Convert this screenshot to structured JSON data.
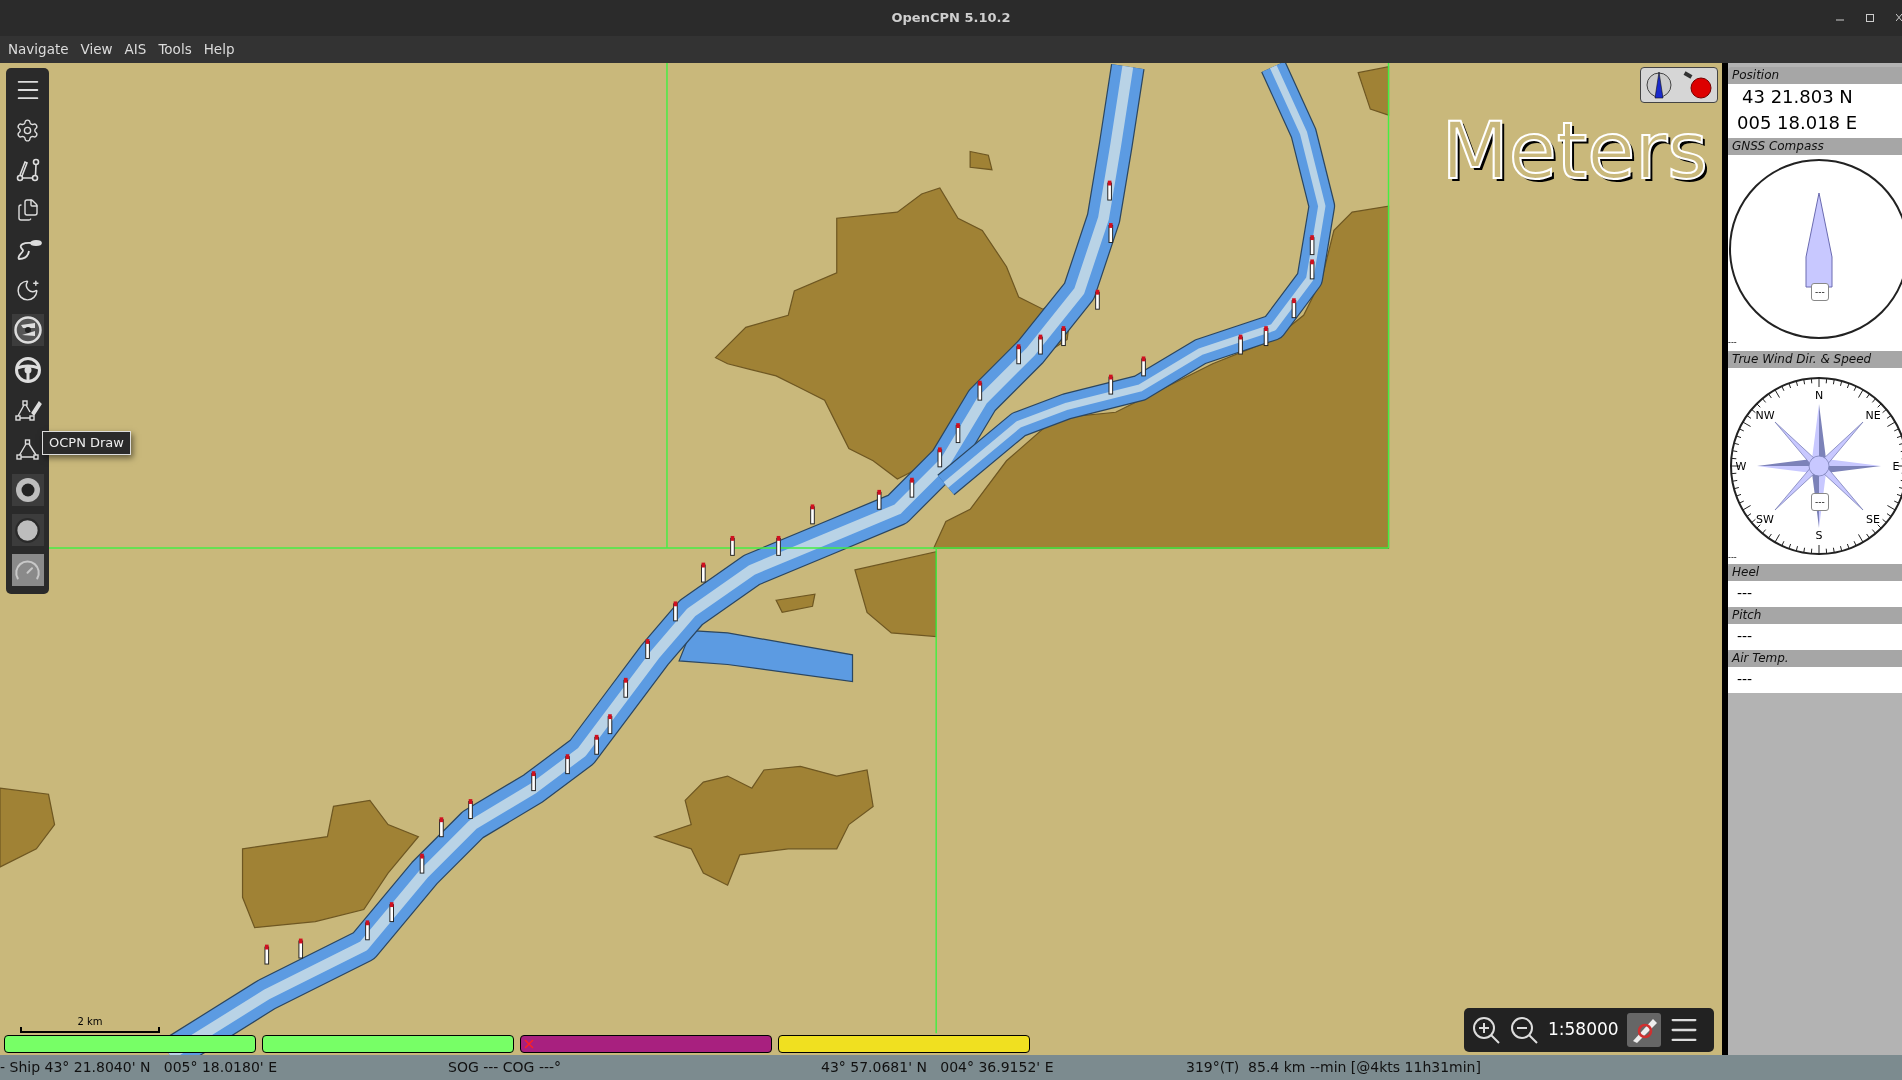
{
  "window": {
    "title": "OpenCPN 5.10.2"
  },
  "menu": [
    "Navigate",
    "View",
    "AIS",
    "Tools",
    "Help"
  ],
  "toolbar": {
    "tooltip": "OCPN Draw"
  },
  "chart": {
    "units_label": "Meters",
    "scale_bar": "2 km",
    "quilt_bars": [
      {
        "color": "#77ff66",
        "marked": false
      },
      {
        "color": "#77ff66",
        "marked": false
      },
      {
        "color": "#a8207f",
        "marked": true
      },
      {
        "color": "#f0e020",
        "marked": false
      }
    ]
  },
  "zoom_control": {
    "scale": "1:58000"
  },
  "dashboard": [
    {
      "kind": "text",
      "title": "Position",
      "lines": [
        "43 21.803 N",
        "005 18.018 E"
      ]
    },
    {
      "kind": "compass",
      "title": "GNSS Compass",
      "reading": "---",
      "footer": "---"
    },
    {
      "kind": "wind",
      "title": "True Wind Dir. & Speed",
      "reading": "---",
      "footer": "---",
      "labels": [
        "N",
        "NE",
        "E",
        "SE",
        "S",
        "SW",
        "W",
        "NW"
      ]
    },
    {
      "kind": "text",
      "title": "Heel",
      "lines": [
        "---"
      ]
    },
    {
      "kind": "text",
      "title": "Pitch",
      "lines": [
        "---"
      ]
    },
    {
      "kind": "text",
      "title": "Air Temp.",
      "lines": [
        "---"
      ]
    }
  ],
  "status_bar": [
    "- Ship 43° 21.8040' N   005° 18.0180' E",
    "SOG --- COG ---°",
    "43° 57.0681' N   004° 36.9152' E",
    "319°(T)  85.4 km --min [@4kts 11h31min]"
  ]
}
